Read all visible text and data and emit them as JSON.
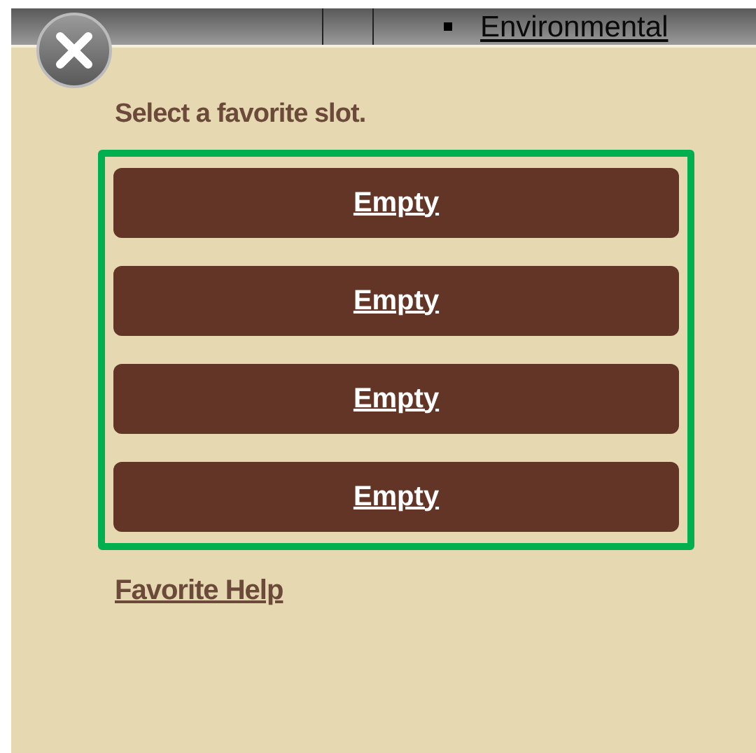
{
  "top_bar": {
    "link": "Environmental"
  },
  "dialog": {
    "prompt": "Select a favorite slot.",
    "slots": [
      {
        "label": "Empty"
      },
      {
        "label": "Empty"
      },
      {
        "label": "Empty"
      },
      {
        "label": "Empty"
      }
    ],
    "help_link": "Favorite Help"
  }
}
